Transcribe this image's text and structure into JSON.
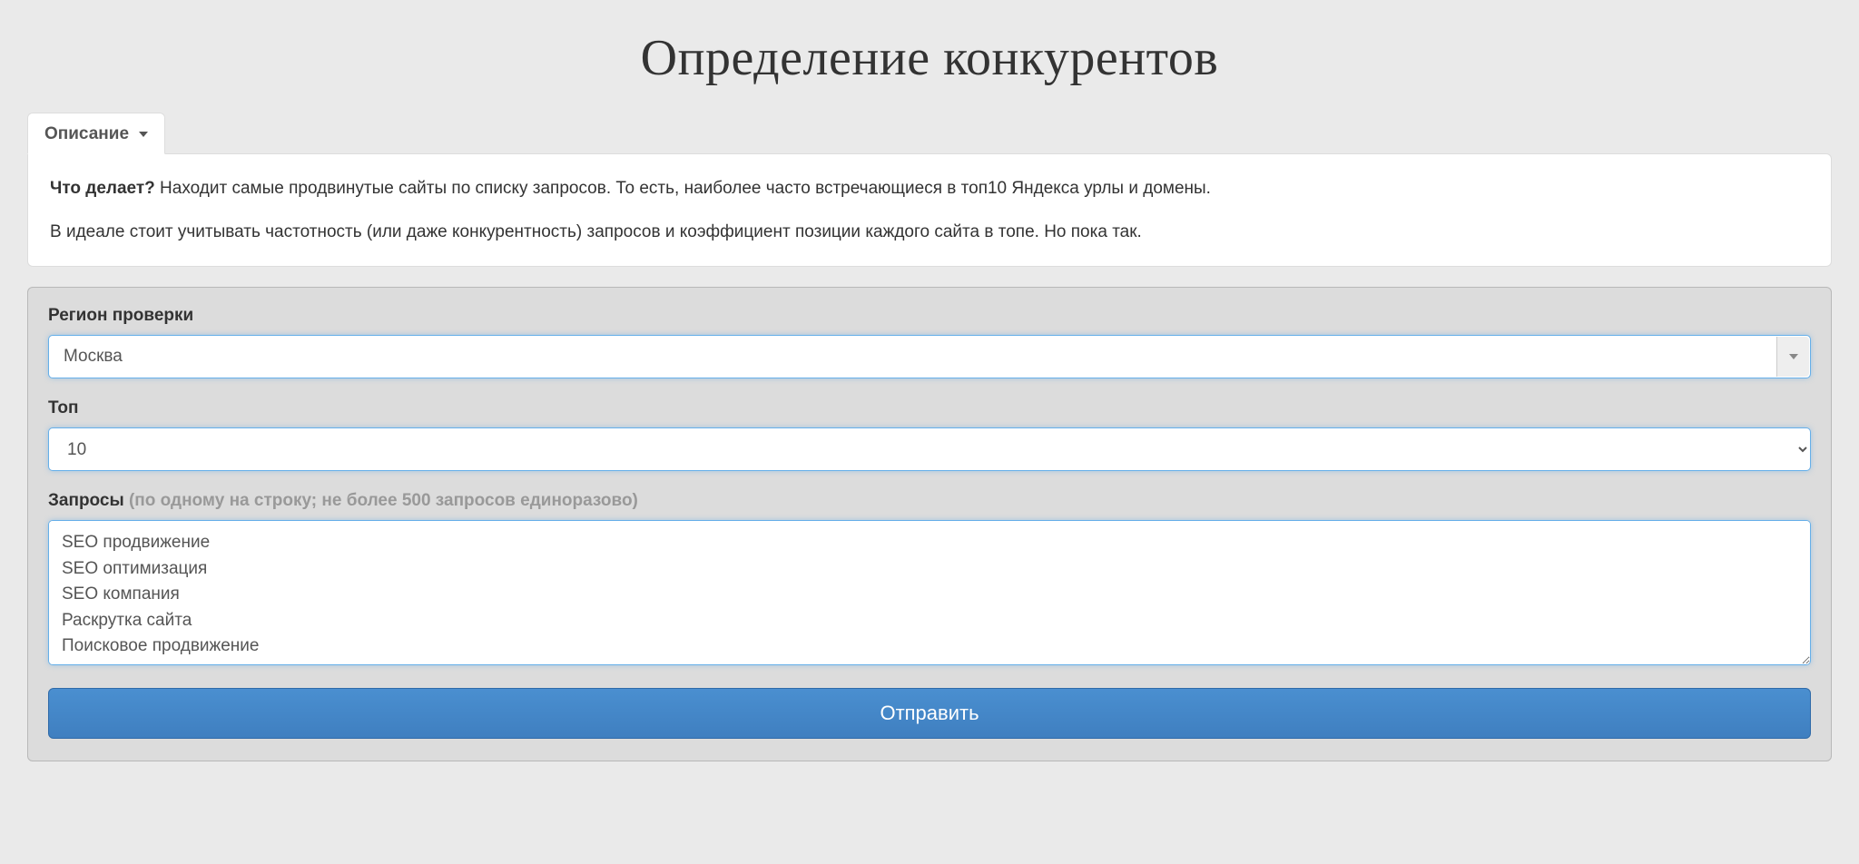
{
  "page": {
    "title": "Определение конкурентов"
  },
  "tab": {
    "label": "Описание"
  },
  "description": {
    "q_label": "Что делает?",
    "q_text": " Находит самые продвинутые сайты по списку запросов. То есть, наиболее часто встречающиеся в топ10 Яндекса урлы и домены.",
    "p2": "В идеале стоит учитывать частотность (или даже конкурентность) запросов и коэффициент позиции каждого сайта в топе. Но пока так."
  },
  "form": {
    "region": {
      "label": "Регион проверки",
      "value": "Москва"
    },
    "top": {
      "label": "Топ",
      "value": "10",
      "options": [
        "10"
      ]
    },
    "queries": {
      "label": "Запросы",
      "hint": " (по одному на строку; не более 500 запросов единоразово)",
      "value": "SEO продвижение\nSEO оптимизация\nSEO компания\nРаскрутка сайта\nПоисковое продвижение"
    },
    "submit_label": "Отправить"
  }
}
